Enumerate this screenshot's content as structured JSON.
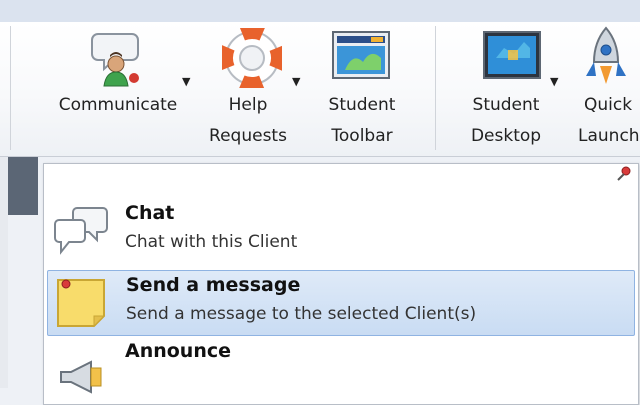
{
  "ribbon": {
    "buttons": [
      {
        "label": "Communicate",
        "icon": "communicate-icon",
        "has_dropdown": true
      },
      {
        "label": "Help\nRequests",
        "line1": "Help",
        "line2": "Requests",
        "icon": "lifebuoy-icon",
        "has_dropdown": true
      },
      {
        "label": "Student\nToolbar",
        "line1": "Student",
        "line2": "Toolbar",
        "icon": "student-toolbar-icon",
        "has_dropdown": false
      },
      {
        "label": "Student\nDesktop",
        "line1": "Student",
        "line2": "Desktop",
        "icon": "student-desktop-icon",
        "has_dropdown": true
      },
      {
        "label": "Quick\nLaunch",
        "line1": "Quick",
        "line2": "Launch",
        "icon": "rocket-icon",
        "has_dropdown": false
      }
    ],
    "dropdown_arrow": "▼"
  },
  "menu": {
    "items": [
      {
        "title": "Chat",
        "description": "Chat with this Client",
        "icon": "chat-bubbles-icon",
        "highlighted": false
      },
      {
        "title": "Send a message",
        "description": "Send a message to the selected Client(s)",
        "icon": "sticky-note-icon",
        "highlighted": true
      },
      {
        "title": "Announce",
        "description": "",
        "icon": "megaphone-icon",
        "highlighted": false
      }
    ],
    "pin_icon": "pin-icon"
  },
  "colors": {
    "highlight": "#c9dcf3",
    "highlight_border": "#8fb3e2",
    "ribbon_bg": "#f8f9fb",
    "lifebuoy_orange": "#e8622c",
    "sticky_yellow": "#f8dc6b"
  }
}
